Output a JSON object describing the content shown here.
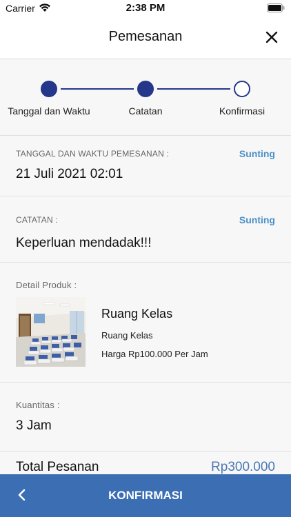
{
  "status_bar": {
    "carrier": "Carrier",
    "time": "2:38 PM"
  },
  "nav": {
    "title": "Pemesanan",
    "close_icon": "close-icon"
  },
  "stepper": {
    "steps": [
      {
        "label": "Tanggal dan Waktu",
        "state": "done"
      },
      {
        "label": "Catatan",
        "state": "done"
      },
      {
        "label": "Konfirmasi",
        "state": "current"
      }
    ],
    "color": "#24378a"
  },
  "booking_datetime": {
    "label": "TANGGAL DAN WAKTU PEMESANAN :",
    "edit_label": "Sunting",
    "value": "21 Juli 2021 02:01"
  },
  "notes": {
    "label": "CATATAN :",
    "edit_label": "Sunting",
    "value": "Keperluan mendadak!!!"
  },
  "product": {
    "label": "Detail Produk :",
    "name": "Ruang Kelas",
    "category": "Ruang Kelas",
    "price": "Harga Rp100.000 Per Jam",
    "image_icon": "classroom-photo"
  },
  "quantity": {
    "label": "Kuantitas :",
    "value": "3 Jam"
  },
  "total": {
    "label": "Total Pesanan",
    "value": "Rp300.000"
  },
  "bottom_bar": {
    "back_icon": "chevron-left-icon",
    "confirm_label": "KONFIRMASI",
    "color": "#3b6eb3"
  },
  "colors": {
    "accent_link": "#4a90c6",
    "total_value": "#4a78b5"
  }
}
